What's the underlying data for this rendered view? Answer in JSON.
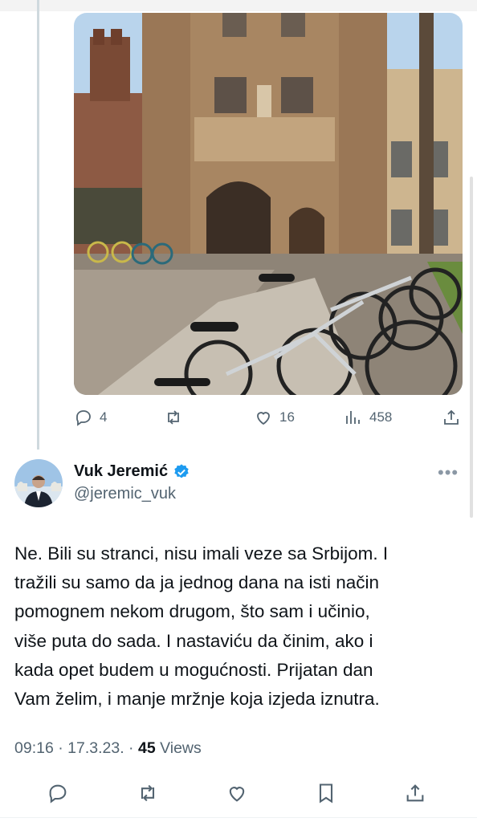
{
  "media": {
    "alt": ""
  },
  "prev_tweet_actions": {
    "replies": "4",
    "likes": "16",
    "views": "458"
  },
  "author": {
    "name": "Vuk Jeremić",
    "handle": "@jeremic_vuk",
    "verified": true
  },
  "tweet": {
    "lines": [
      "Ne. Bili su stranci, nisu imali veze sa Srbijom. I",
      "tražili su samo da ja jednog dana na isti način",
      "pomognem nekom drugom, što sam i učinio,",
      "više puta do sada. I nastaviću da činim, ako i",
      "kada opet budem u mogućnosti. Prijatan dan",
      "Vam želim, i manje mržnje koja izjeda iznutra."
    ],
    "time": "09:16",
    "sep1": " · ",
    "date": "17.3.23.",
    "sep2": " · ",
    "views_count": "45",
    "views_label": " Views"
  },
  "colors": {
    "accent": "#1d9bf0",
    "muted": "#536471",
    "thread_line": "#cfd9de"
  },
  "more_label": "•••"
}
